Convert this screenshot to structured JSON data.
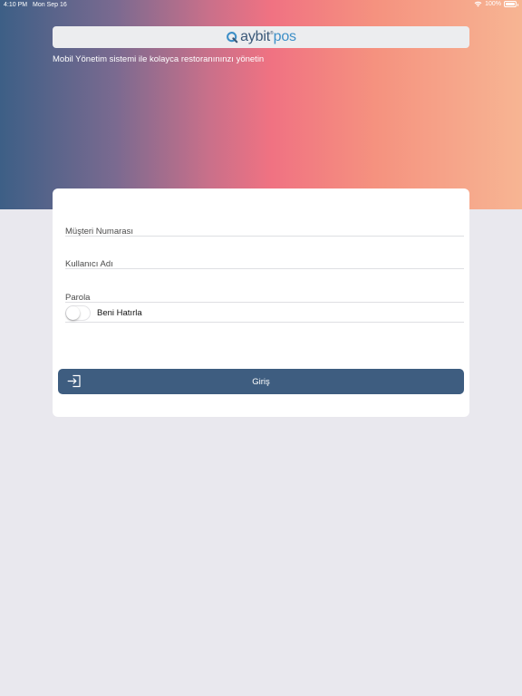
{
  "status_bar": {
    "time": "4:10 PM",
    "date": "Mon Sep 16",
    "battery": "100%",
    "battery_level": 1.0
  },
  "brand": {
    "logo_main": "aybit",
    "logo_reg": "®",
    "logo_accent": "pos",
    "tagline": "Mobil Yönetim sistemi ile kolayca restoranınınzı yönetin"
  },
  "form": {
    "customer_number": {
      "placeholder": "Müşteri Numarası",
      "value": ""
    },
    "username": {
      "placeholder": "Kullanıcı Adı",
      "value": ""
    },
    "password": {
      "placeholder": "Parola",
      "value": ""
    },
    "remember_me": {
      "label": "Beni Hatırla",
      "checked": false
    },
    "login_button": {
      "label": "Giriş",
      "icon": "login-icon"
    }
  },
  "colors": {
    "primary": "#3e5d80",
    "logo_accent": "#3d8fc7",
    "background": "#e9e8ee",
    "gradient": [
      "#3d5f86",
      "#f07282",
      "#f7b593"
    ]
  }
}
